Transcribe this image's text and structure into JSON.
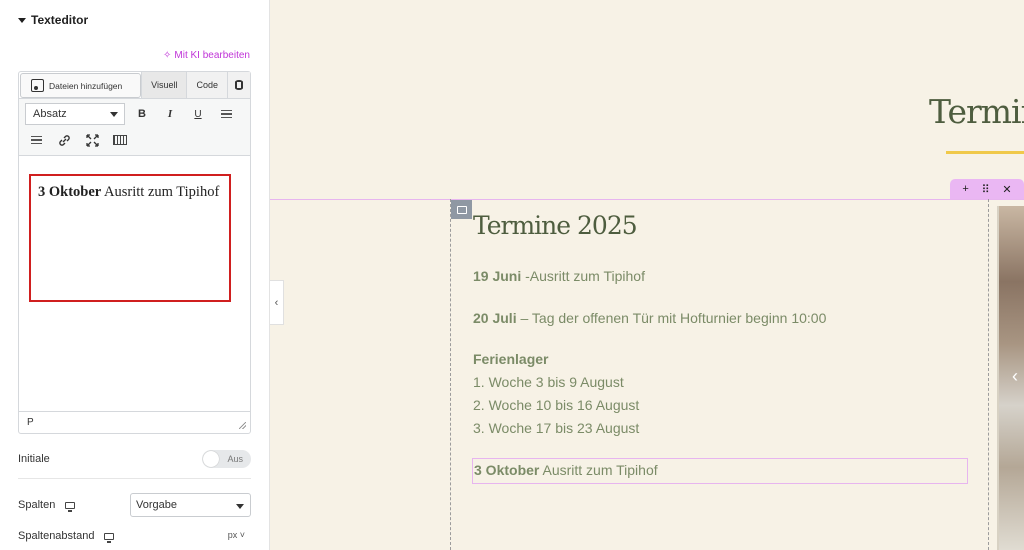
{
  "panel": {
    "section_title": "Texteditor",
    "ai_edit_label": "Mit KI bearbeiten",
    "add_media_label": "Dateien hinzufügen",
    "tabs": {
      "visual": "Visuell",
      "code": "Code"
    },
    "format_select_value": "Absatz",
    "toolbar": {
      "bold": "B",
      "italic": "I",
      "underline": "U"
    },
    "content": {
      "bold_part": "3 Oktober",
      "rest": " Ausritt zum Tipihof"
    },
    "status_path": "P",
    "initial_label": "Initiale",
    "initial_toggle_state": "Aus",
    "columns_label": "Spalten",
    "columns_value": "Vorgabe",
    "column_gap_label": "Spaltenabstand",
    "column_gap_unit": "px"
  },
  "canvas": {
    "hero_title": "Termine",
    "content_title": "Termine 2025",
    "events": [
      {
        "date": "19 Juni",
        "text": " -Ausritt zum Tipihof"
      },
      {
        "date": "20 Juli",
        "text": " – Tag der offenen Tür mit Hofturnier beginn 10:00"
      }
    ],
    "camp_heading": "Ferienlager",
    "camp_weeks": [
      "1. Woche 3 bis 9 August",
      "2. Woche 10 bis 16 August",
      "3. Woche 17 bis 23 August"
    ],
    "selected_event": {
      "date": "3 Oktober",
      "text": " Ausritt zum Tipihof"
    },
    "handle_icons": {
      "add": "+",
      "move": "⠿",
      "close": "✕"
    }
  },
  "icons": {
    "ai": "sparkle-icon",
    "media": "media-icon",
    "collapse": "chevron-left-icon"
  },
  "colors": {
    "accent_pink": "#c035d8",
    "selection_red": "#d01f1f",
    "text_olive": "#4e5d3f",
    "text_green": "#7b8b67",
    "underline_yellow": "#f0c94a",
    "canvas_bg": "#f7f2e6"
  }
}
